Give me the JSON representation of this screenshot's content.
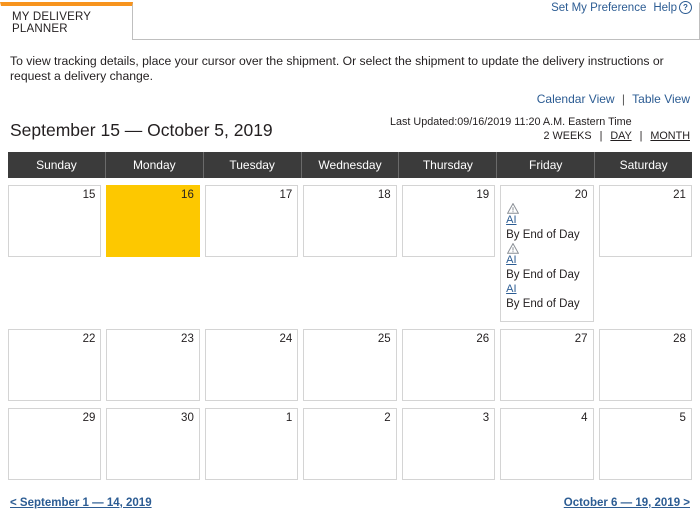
{
  "tab": {
    "label": "MY DELIVERY PLANNER"
  },
  "top_links": {
    "preference": "Set My Preference",
    "help": "Help",
    "help_icon": "question-circle-icon"
  },
  "instruction": "To view tracking details, place your cursor over the shipment. Or select the shipment to update the delivery instructions or request a delivery change.",
  "view_links": {
    "calendar": "Calendar View",
    "divider": "|",
    "table": "Table View"
  },
  "title": {
    "range": "September 15 — October 5, 2019",
    "last_updated": "Last Updated:09/16/2019 11:20 A.M. Eastern Time"
  },
  "span_links": {
    "two_weeks": "2 WEEKS",
    "sep1": "|",
    "day": "DAY",
    "sep2": "|",
    "month": "MONTH"
  },
  "calendar": {
    "weekdays": [
      "Sunday",
      "Monday",
      "Tuesday",
      "Wednesday",
      "Thursday",
      "Friday",
      "Saturday"
    ],
    "rows": [
      {
        "days": [
          {
            "num": "15"
          },
          {
            "num": "16"
          },
          {
            "num": "17"
          },
          {
            "num": "18"
          },
          {
            "num": "19"
          },
          {
            "num": "20",
            "shipments": [
              {
                "warning": true,
                "warning_icon": "warning-triangle-icon",
                "link": "AI",
                "when": "By End of Day"
              },
              {
                "warning": true,
                "warning_icon": "warning-triangle-icon",
                "link": "AI",
                "when": "By End of Day"
              },
              {
                "warning": false,
                "link": "AI",
                "when": "By End of Day"
              }
            ]
          },
          {
            "num": "21"
          }
        ]
      },
      {
        "days": [
          {
            "num": "22"
          },
          {
            "num": "23"
          },
          {
            "num": "24"
          },
          {
            "num": "25"
          },
          {
            "num": "26"
          },
          {
            "num": "27"
          },
          {
            "num": "28"
          }
        ]
      },
      {
        "days": [
          {
            "num": "29"
          },
          {
            "num": "30"
          },
          {
            "num": "1"
          },
          {
            "num": "2"
          },
          {
            "num": "3"
          },
          {
            "num": "4"
          },
          {
            "num": "5"
          }
        ]
      }
    ]
  },
  "footer": {
    "prev": "< September 1 — 14, 2019",
    "next": "October 6 — 19, 2019 >"
  },
  "colors": {
    "accent_orange": "#f7941e",
    "header_dark": "#3b3b3b",
    "today_yellow": "#fdc800",
    "link_blue": "#2c5c93"
  }
}
